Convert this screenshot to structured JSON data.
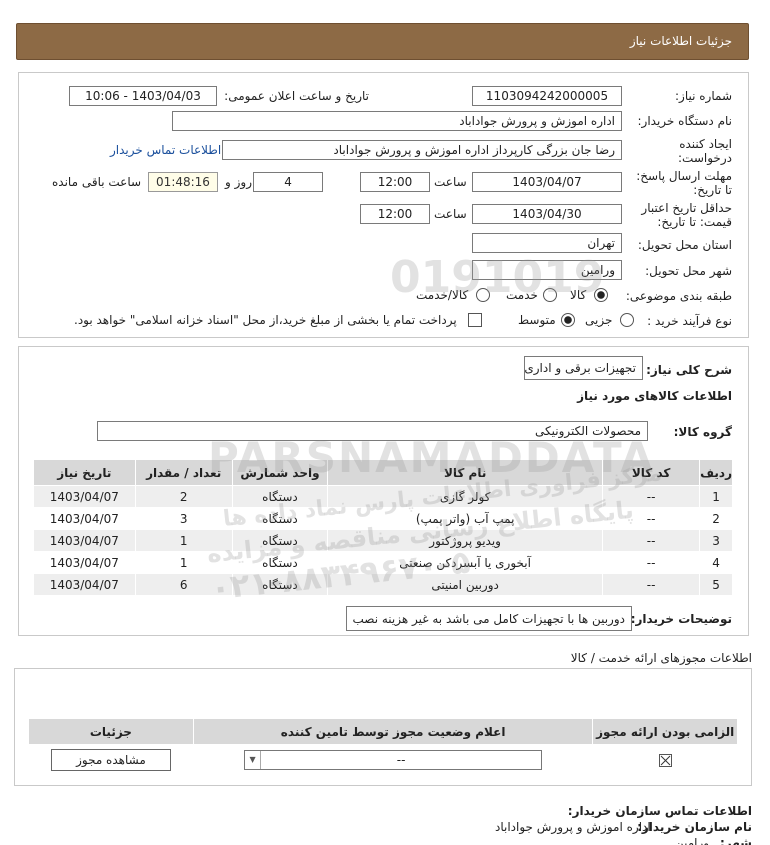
{
  "header": {
    "title": "جزئیات اطلاعات نیاز"
  },
  "form": {
    "need_number_label": "شماره نیاز:",
    "need_number": "1103094242000005",
    "announce_label": "تاریخ و ساعت اعلان عمومی:",
    "announce_value": "1403/04/03 - 10:06",
    "buyer_label": "نام دستگاه خریدار:",
    "buyer_value": "اداره اموزش و پرورش جواداباد",
    "creator_label_1": "ایجاد کننده",
    "creator_label_2": "درخواست:",
    "creator_value": "رضا جان بزرگی کارپرداز اداره اموزش و پرورش جواداباد",
    "contact_link": "اطلاعات تماس خریدار",
    "deadline_label_1": "مهلت ارسال پاسخ:",
    "deadline_label_2": "تا تاریخ:",
    "deadline_date": "1403/04/07",
    "time_label": "ساعت",
    "deadline_time": "12:00",
    "days_value": "4",
    "days_label": "روز و",
    "remaining_time": "01:48:16",
    "remaining_label": "ساعت باقی مانده",
    "validity_label_1": "حداقل تاریخ اعتبار",
    "validity_label_2": "قیمت: تا تاریخ:",
    "validity_date": "1403/04/30",
    "validity_time": "12:00",
    "province_label": "استان محل تحویل:",
    "province_value": "تهران",
    "city_label": "شهر محل تحویل:",
    "city_value": "ورامین",
    "category_label": "طبقه بندی موضوعی:",
    "category_options": [
      "کالا",
      "خدمت",
      "کالا/خدمت"
    ],
    "process_label": "نوع فرآیند خرید :",
    "process_options": [
      "جزیی",
      "متوسط"
    ],
    "payment_note": "پرداخت تمام یا بخشی از مبلغ خرید،از محل \"اسناد خزانه اسلامی\" خواهد بود."
  },
  "summary": {
    "need_desc_label": "شرح کلی نیاز:",
    "need_desc_value": "تجهیزات برقی و اداری",
    "goods_info_title": "اطلاعات کالاهای مورد نیاز",
    "goods_group_label": "گروه کالا:",
    "goods_group_value": "محصولات الکترونیکی"
  },
  "goods_table": {
    "headers": [
      "ردیف",
      "کد کالا",
      "نام کالا",
      "واحد شمارش",
      "تعداد / مقدار",
      "تاریخ نیاز"
    ],
    "rows": [
      {
        "idx": "1",
        "code": "--",
        "name": "کولر گازی",
        "unit": "دستگاه",
        "qty": "2",
        "date": "1403/04/07"
      },
      {
        "idx": "2",
        "code": "--",
        "name": "پمپ آب (واتر پمپ)",
        "unit": "دستگاه",
        "qty": "3",
        "date": "1403/04/07"
      },
      {
        "idx": "3",
        "code": "--",
        "name": "ویدیو پروژکتور",
        "unit": "دستگاه",
        "qty": "1",
        "date": "1403/04/07"
      },
      {
        "idx": "4",
        "code": "--",
        "name": "آبخوری یا آبسردکن صنعتی",
        "unit": "دستگاه",
        "qty": "1",
        "date": "1403/04/07"
      },
      {
        "idx": "5",
        "code": "--",
        "name": "دوربین امنیتی",
        "unit": "دستگاه",
        "qty": "6",
        "date": "1403/04/07"
      }
    ]
  },
  "buyer_notes": {
    "label": "توضیحات خریدار:",
    "value": "دوربین ها با تجهیزات کامل می باشد به غیر هزینه نصب"
  },
  "permits": {
    "title": "اطلاعات مجوزهای ارائه خدمت / کالا",
    "headers": [
      "الزامی بودن ارائه مجوز",
      "اعلام وضعیت مجوز توسط تامین کننده",
      "جزئیات"
    ],
    "select_value": "--",
    "view_button": "مشاهده مجوز"
  },
  "contact": {
    "title": "اطلاعات تماس سازمان خریدار:",
    "org_label": "نام سازمان خریدار:",
    "org_value": "اداره اموزش و پرورش جواداباد",
    "city_label": "شهر:",
    "city_value": "ورامین"
  },
  "watermark": {
    "line1": "PARSNAMADDATA",
    "line2": "مرکز فراوری اطلاعات پارس نماد داده ها",
    "line3": "پایگاه اطلاع رسانی مناقصه و مزایده",
    "line4": "۰۲۱-۸۸۳۴۹۶۷۰-۵",
    "digits": "0191019"
  },
  "colors": {
    "header": "#8d6a45",
    "table_header": "#d8d8d8",
    "link": "#1a4f9c"
  }
}
